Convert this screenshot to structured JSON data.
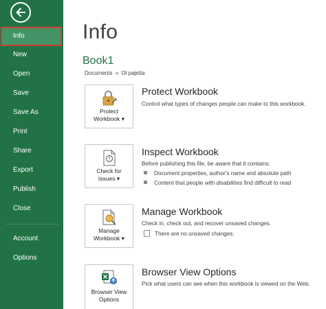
{
  "sidebar": {
    "items": [
      {
        "label": "Info"
      },
      {
        "label": "New"
      },
      {
        "label": "Open"
      },
      {
        "label": "Save"
      },
      {
        "label": "Save As"
      },
      {
        "label": "Print"
      },
      {
        "label": "Share"
      },
      {
        "label": "Export"
      },
      {
        "label": "Publish"
      },
      {
        "label": "Close"
      },
      {
        "label": "Account"
      },
      {
        "label": "Options"
      }
    ]
  },
  "main": {
    "title": "Info",
    "book_name": "Book1",
    "path": {
      "part1": "Documents",
      "separator": "»",
      "part2": "Ol pajetta"
    },
    "sections": [
      {
        "tile_label_line1": "Protect",
        "tile_label_line2": "Workbook ▾",
        "title": "Protect Workbook",
        "description": "Control what types of changes people can make to this workbook."
      },
      {
        "tile_label_line1": "Check for",
        "tile_label_line2": "Issues ▾",
        "title": "Inspect Workbook",
        "description": "Before publishing this file, be aware that it contains:",
        "bullets": [
          "Document properties, author's name and absolute path",
          "Content that people with disabilities find difficult to read"
        ]
      },
      {
        "tile_label_line1": "Manage",
        "tile_label_line2": "Workbook ▾",
        "title": "Manage Workbook",
        "description": "Check in, check out, and recover unsaved changes.",
        "note": "There are no unsaved changes."
      },
      {
        "tile_label_line1": "Browser View",
        "tile_label_line2": "Options",
        "title": "Browser View Options",
        "description": "Pick what users can see when this workbook is viewed on the Web."
      }
    ]
  },
  "colors": {
    "sidebar_bg": "#217346",
    "active_item_bg": "#439467",
    "active_item_border": "#d43e35",
    "accent_green": "#217346"
  },
  "icons": {
    "back": "back-arrow-icon",
    "protect": "lock-icon",
    "inspect": "inspect-document-icon",
    "manage": "manage-workbook-icon",
    "browser": "browser-view-icon"
  }
}
